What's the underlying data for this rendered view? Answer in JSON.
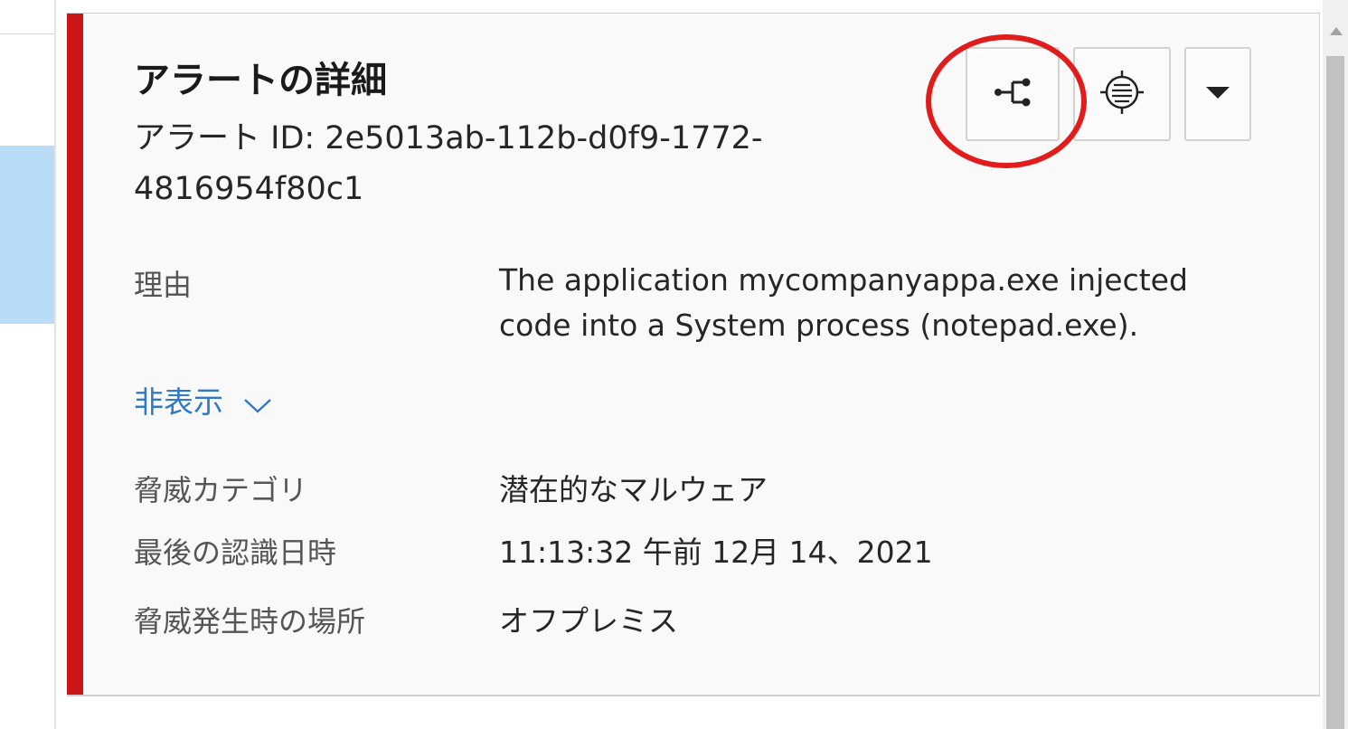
{
  "alert": {
    "title": "アラートの詳細",
    "id_text": "アラート ID: 2e5013ab-112b-d0f9-1772-4816954f80c1",
    "reason_label": "理由",
    "reason_value": "The application mycompanyappa.exe injected code into a System process (notepad.exe).",
    "toggle_label": "非表示",
    "threat_category_label": "脅威カテゴリ",
    "threat_category_value": "潜在的なマルウェア",
    "last_seen_label": "最後の認識日時",
    "last_seen_value": "11:13:32 午前 12月 14、2021",
    "location_label": "脅威発生時の場所",
    "location_value": "オフプレミス"
  },
  "toolbar": {
    "buttons": [
      "process-graph-icon",
      "filter-list-icon",
      "caret-down-icon"
    ]
  },
  "colors": {
    "accent_red": "#cc1414",
    "highlight_ring": "#e21b1b",
    "link_blue": "#2f79c8",
    "selected_row": "#b9dcf7"
  }
}
